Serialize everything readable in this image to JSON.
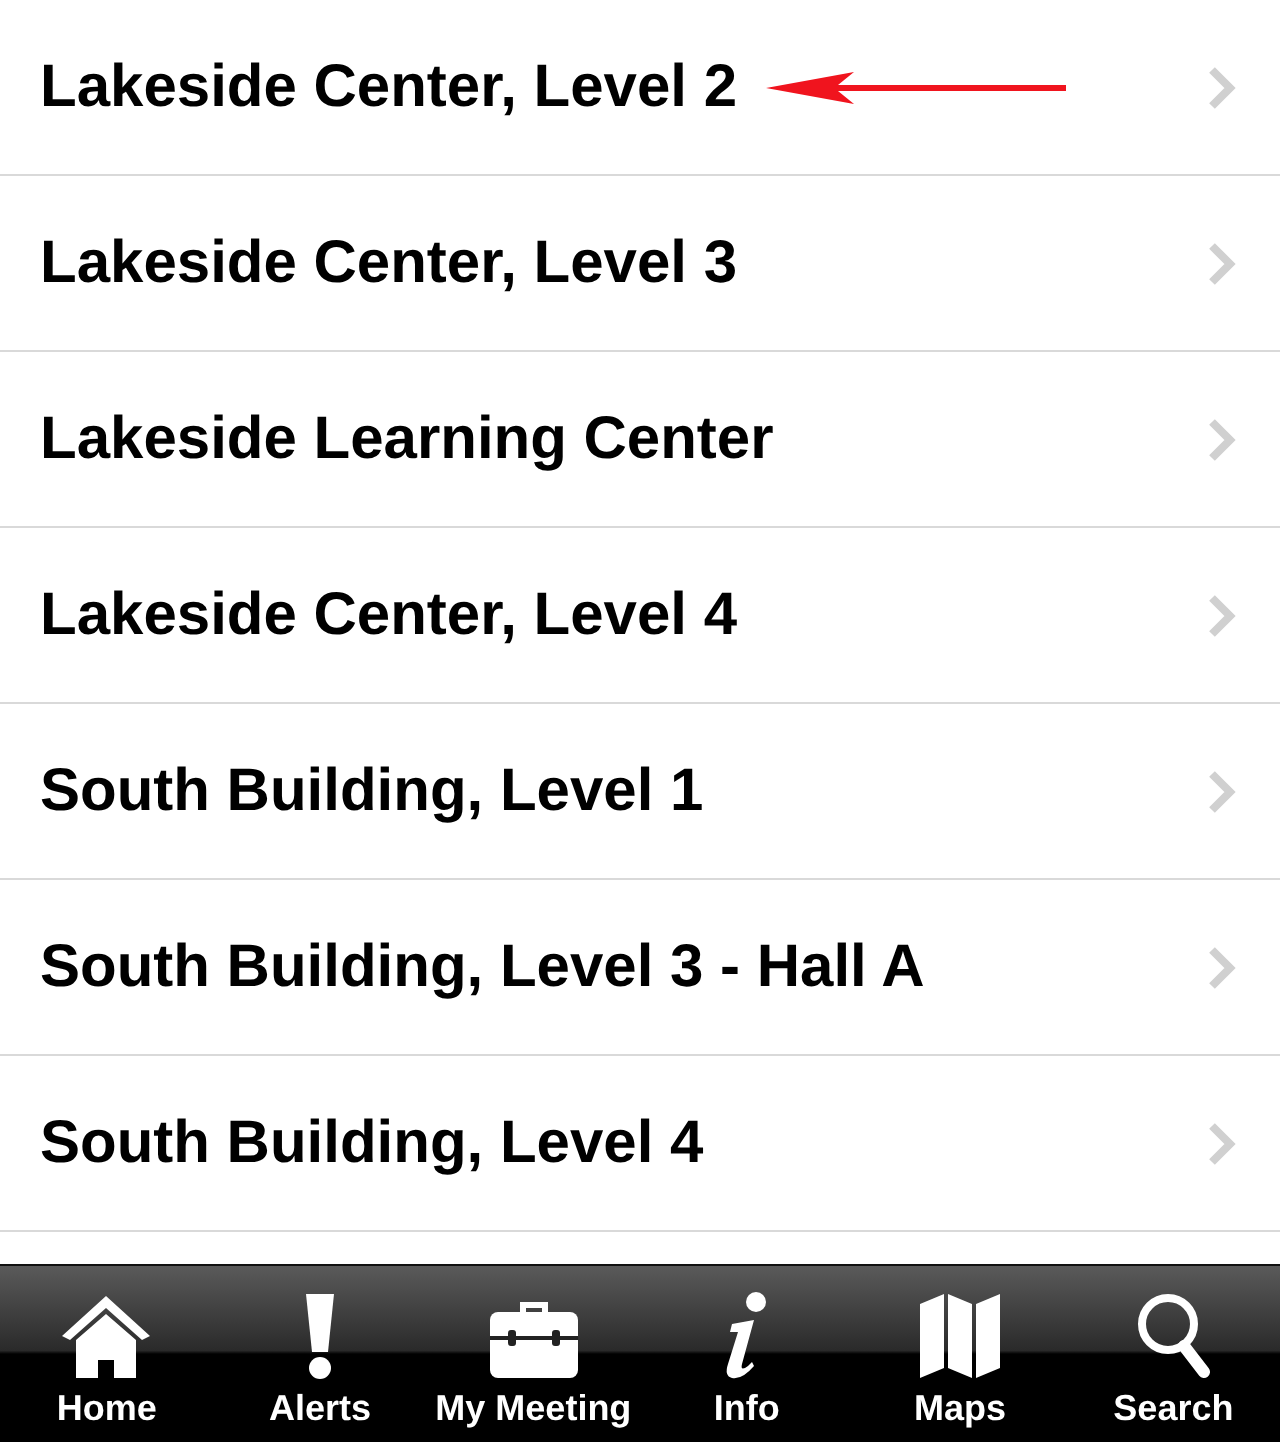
{
  "list": {
    "rows": [
      {
        "label": "Lakeside Center, Level 2",
        "marked": true
      },
      {
        "label": "Lakeside Center, Level 3",
        "marked": false
      },
      {
        "label": "Lakeside Learning Center",
        "marked": false
      },
      {
        "label": "Lakeside Center, Level 4",
        "marked": false
      },
      {
        "label": "South Building, Level 1",
        "marked": false
      },
      {
        "label": "South Building, Level 3 - Hall A",
        "marked": false
      },
      {
        "label": "South Building, Level 4",
        "marked": false
      }
    ]
  },
  "tab_bar": {
    "tabs": [
      {
        "label": "Home",
        "kind": "home"
      },
      {
        "label": "Alerts",
        "kind": "alert"
      },
      {
        "label": "My Meeting",
        "kind": "briefcase"
      },
      {
        "label": "Info",
        "kind": "info"
      },
      {
        "label": "Maps",
        "kind": "map"
      },
      {
        "label": "Search",
        "kind": "search"
      }
    ]
  }
}
